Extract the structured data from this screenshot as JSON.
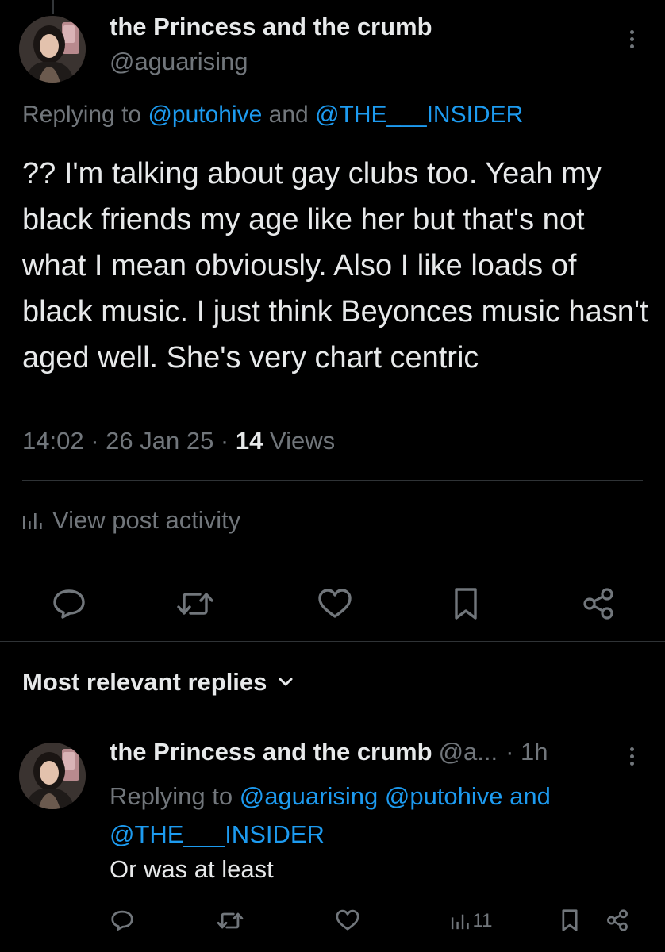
{
  "post": {
    "author_name": "the Princess and the crumb",
    "author_handle": "@aguarising",
    "replying_prefix": "Replying to ",
    "replying_user_1": "@putohive",
    "replying_and": " and ",
    "replying_user_2": "@THE___INSIDER",
    "text": "?? I'm talking about gay clubs too. Yeah my black friends my age like her but that's not what I mean obviously. Also I like loads of black music. I just think Beyonces music hasn't aged well. She's very chart centric",
    "time": "14:02",
    "sep1": " · ",
    "date": "26 Jan 25",
    "sep2": " · ",
    "views_count": "14",
    "views_label": " Views",
    "activity_label": "View post activity",
    "actions": {
      "reply_icon": "reply-icon",
      "repost_icon": "repost-icon",
      "like_icon": "heart-icon",
      "bookmark_icon": "bookmark-icon",
      "share_icon": "share-icon"
    }
  },
  "replies_section": {
    "title": "Most relevant replies"
  },
  "reply": {
    "author_name": "the Princess and the crumb",
    "author_handle": "@a...",
    "time": "· 1h",
    "replying_prefix": "Replying to ",
    "replying_user_1": "@aguarising",
    "replying_user_2": "@putohive",
    "replying_and": " and",
    "replying_user_3": "@THE___INSIDER",
    "text": "Or was at least",
    "views": "11"
  },
  "colors": {
    "background": "#000000",
    "text": "#e7e9ea",
    "muted": "#71767b",
    "link": "#1d9bf0",
    "divider": "#2f3336"
  }
}
